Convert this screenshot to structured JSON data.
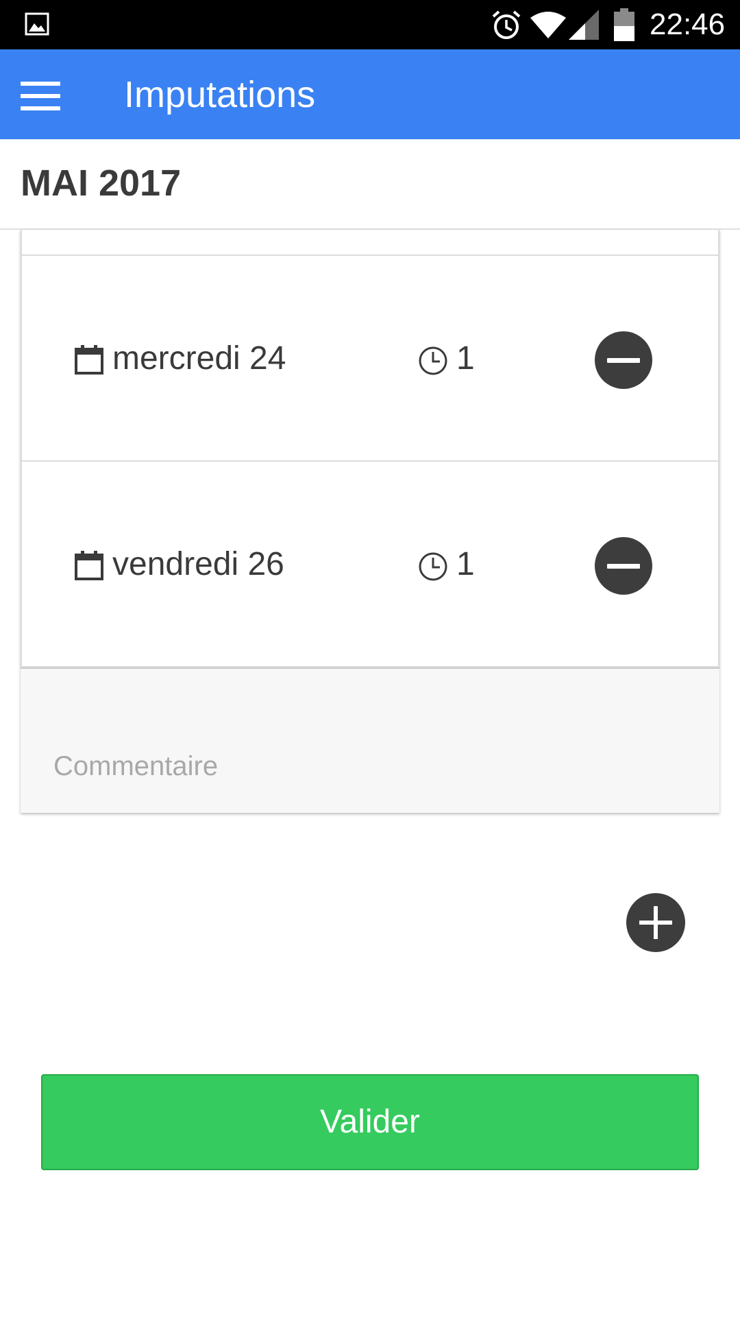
{
  "status_bar": {
    "time": "22:46",
    "icons": [
      "gallery-icon",
      "alarm-icon",
      "wifi-icon",
      "signal-icon",
      "battery-icon"
    ]
  },
  "app_bar": {
    "title": "Imputations",
    "menu_icon": "hamburger-menu-icon",
    "background_color": "#3a82f3"
  },
  "month": {
    "label": "MAI 2017"
  },
  "entries": [
    {
      "day": "mercredi 24",
      "hours": "1",
      "action_icon": "minus-circle-icon"
    },
    {
      "day": "vendredi 26",
      "hours": "1",
      "action_icon": "minus-circle-icon"
    }
  ],
  "comment": {
    "placeholder": "Commentaire",
    "value": ""
  },
  "add_button": {
    "icon": "plus-circle-icon"
  },
  "validate_button": {
    "label": "Valider",
    "color": "#35cb5e"
  }
}
